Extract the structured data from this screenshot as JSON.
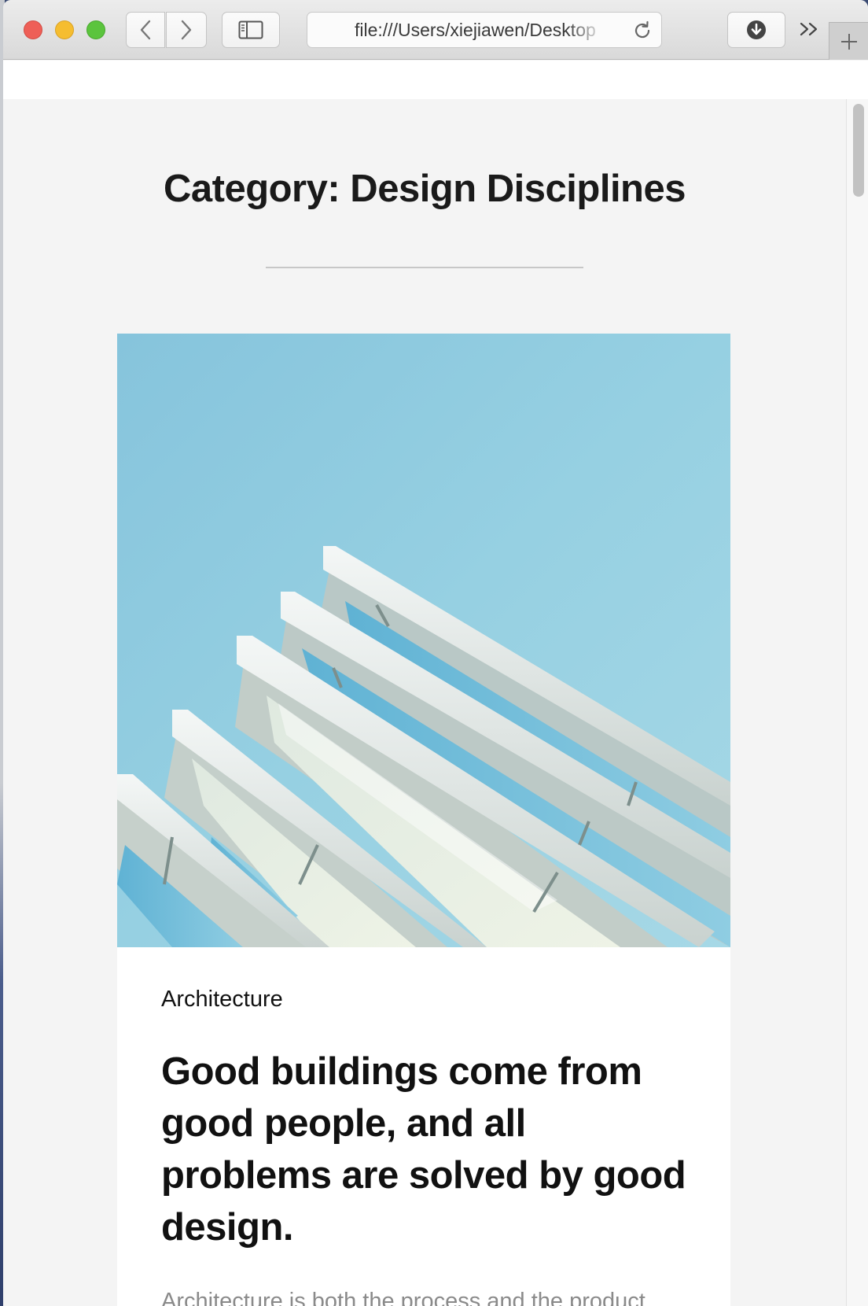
{
  "browser": {
    "url": "file:///Users/xiejiawen/Desktop",
    "buttons": {
      "back": "back",
      "forward": "forward",
      "sidebar": "sidebar",
      "reload": "reload",
      "downloads": "downloads",
      "overflow": "more",
      "new_tab": "new tab"
    },
    "icons": {
      "back": "chevron-left-icon",
      "forward": "chevron-right-icon",
      "sidebar": "sidebar-icon",
      "reload": "reload-icon",
      "downloads": "download-icon",
      "overflow": "double-chevron-icon",
      "new_tab": "plus-icon"
    }
  },
  "page": {
    "title": "Category: Design Disciplines",
    "post": {
      "category": "Architecture",
      "title": "Good buildings come from good people, and all problems are solved by good design.",
      "excerpt": "Architecture is both the process and the product"
    }
  },
  "colors": {
    "page_bg": "#f4f4f4",
    "card_bg": "#ffffff",
    "sky": "#8ccbe0",
    "title_text": "#1a1a1a",
    "excerpt_text": "#8a8a8a"
  }
}
